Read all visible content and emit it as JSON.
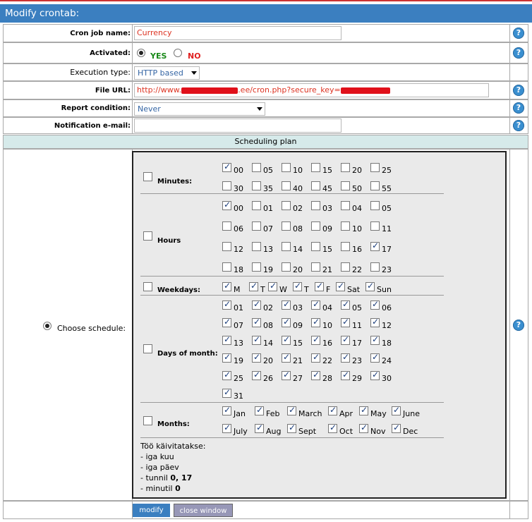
{
  "title": "Modify crontab:",
  "fields": {
    "name_label": "Cron job name:",
    "name_value": "Currency",
    "activated_label": "Activated:",
    "yes": "YES",
    "no": "NO",
    "exec_label": "Execution type:",
    "exec_value": "HTTP based",
    "url_label": "File URL:",
    "url_prefix": "http://www.",
    "url_middle": ".ee/cron.php?secure_key=",
    "report_label": "Report condition:",
    "report_value": "Never",
    "email_label": "Notification e-mail:",
    "email_value": ""
  },
  "schedule": {
    "header": "Scheduling plan",
    "choose_label": "Choose schedule:",
    "minutes_label": "Minutes:",
    "hours_label": "Hours",
    "weekdays_label": "Weekdays:",
    "dom_label": "Days of month:",
    "months_label": "Months:",
    "minutes": [
      {
        "l": "00",
        "c": true
      },
      {
        "l": "05",
        "c": false
      },
      {
        "l": "10",
        "c": false
      },
      {
        "l": "15",
        "c": false
      },
      {
        "l": "20",
        "c": false
      },
      {
        "l": "25",
        "c": false
      },
      {
        "l": "30",
        "c": false
      },
      {
        "l": "35",
        "c": false
      },
      {
        "l": "40",
        "c": false
      },
      {
        "l": "45",
        "c": false
      },
      {
        "l": "50",
        "c": false
      },
      {
        "l": "55",
        "c": false
      }
    ],
    "hours": [
      {
        "l": "00",
        "c": true
      },
      {
        "l": "01",
        "c": false
      },
      {
        "l": "02",
        "c": false
      },
      {
        "l": "03",
        "c": false
      },
      {
        "l": "04",
        "c": false
      },
      {
        "l": "05",
        "c": false
      },
      {
        "l": "06",
        "c": false
      },
      {
        "l": "07",
        "c": false
      },
      {
        "l": "08",
        "c": false
      },
      {
        "l": "09",
        "c": false
      },
      {
        "l": "10",
        "c": false
      },
      {
        "l": "11",
        "c": false
      },
      {
        "l": "12",
        "c": false
      },
      {
        "l": "13",
        "c": false
      },
      {
        "l": "14",
        "c": false
      },
      {
        "l": "15",
        "c": false
      },
      {
        "l": "16",
        "c": false
      },
      {
        "l": "17",
        "c": true
      },
      {
        "l": "18",
        "c": false
      },
      {
        "l": "19",
        "c": false
      },
      {
        "l": "20",
        "c": false
      },
      {
        "l": "21",
        "c": false
      },
      {
        "l": "22",
        "c": false
      },
      {
        "l": "23",
        "c": false
      }
    ],
    "weekdays": [
      {
        "l": "M",
        "c": true
      },
      {
        "l": "T",
        "c": true
      },
      {
        "l": "W",
        "c": true
      },
      {
        "l": "T",
        "c": true
      },
      {
        "l": "F",
        "c": true
      },
      {
        "l": "Sat",
        "c": true
      },
      {
        "l": "Sun",
        "c": true
      }
    ],
    "days": [
      "01",
      "02",
      "03",
      "04",
      "05",
      "06",
      "07",
      "08",
      "09",
      "10",
      "11",
      "12",
      "13",
      "14",
      "15",
      "16",
      "17",
      "18",
      "19",
      "20",
      "21",
      "22",
      "23",
      "24",
      "25",
      "26",
      "27",
      "28",
      "29",
      "30",
      "31"
    ],
    "months": [
      "Jan",
      "Feb",
      "March",
      "Apr",
      "May",
      "June",
      "July",
      "Aug",
      "Sept",
      "Oct",
      "Nov",
      "Dec"
    ],
    "summary_title": "Töö käivitatakse:",
    "summary": [
      {
        "t": "- iga kuu",
        "b": ""
      },
      {
        "t": "- iga päev",
        "b": ""
      },
      {
        "t": "- tunnil ",
        "b": "0, 17"
      },
      {
        "t": "- minutil ",
        "b": "0"
      }
    ]
  },
  "buttons": {
    "modify": "modify",
    "close": "close window"
  },
  "colors": {
    "title_bg": "#3b7fc0",
    "accent_red": "#d32",
    "yes_green": "#1a8a1a",
    "no_red": "#e02020",
    "help_blue": "#3a8fd0"
  }
}
